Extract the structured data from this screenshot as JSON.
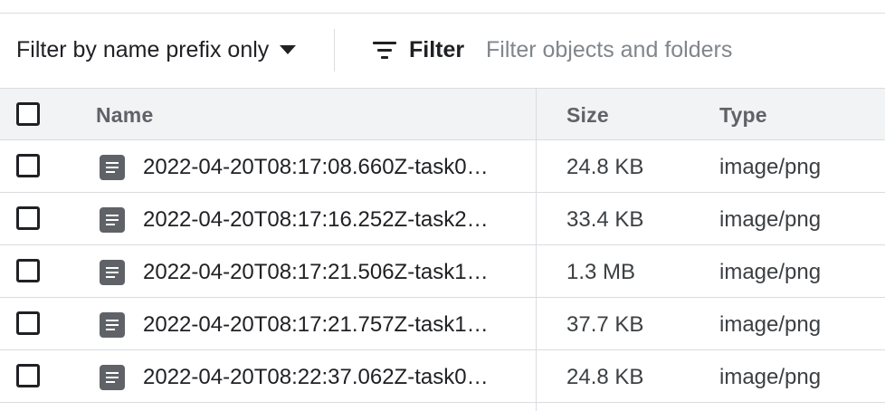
{
  "toolbar": {
    "prefix_filter_label": "Filter by name prefix only",
    "filter_button_label": "Filter",
    "filter_placeholder": "Filter objects and folders"
  },
  "table": {
    "columns": {
      "name": "Name",
      "size": "Size",
      "type": "Type"
    },
    "rows": [
      {
        "name": "2022-04-20T08:17:08.660Z-task0…",
        "size": "24.8 KB",
        "type": "image/png"
      },
      {
        "name": "2022-04-20T08:17:16.252Z-task2…",
        "size": "33.4 KB",
        "type": "image/png"
      },
      {
        "name": "2022-04-20T08:17:21.506Z-task1…",
        "size": "1.3 MB",
        "type": "image/png"
      },
      {
        "name": "2022-04-20T08:17:21.757Z-task1…",
        "size": "37.7 KB",
        "type": "image/png"
      },
      {
        "name": "2022-04-20T08:22:37.062Z-task0…",
        "size": "24.8 KB",
        "type": "image/png"
      }
    ]
  },
  "icons": {
    "prefix_dropdown": "caret-down-icon",
    "filter": "filter-list-icon",
    "file": "document-icon"
  },
  "colors": {
    "text": "#202124",
    "muted": "#5f6368",
    "header_bg": "#f1f3f4",
    "divider": "#dadce0",
    "icon_fill": "#5f6368"
  }
}
